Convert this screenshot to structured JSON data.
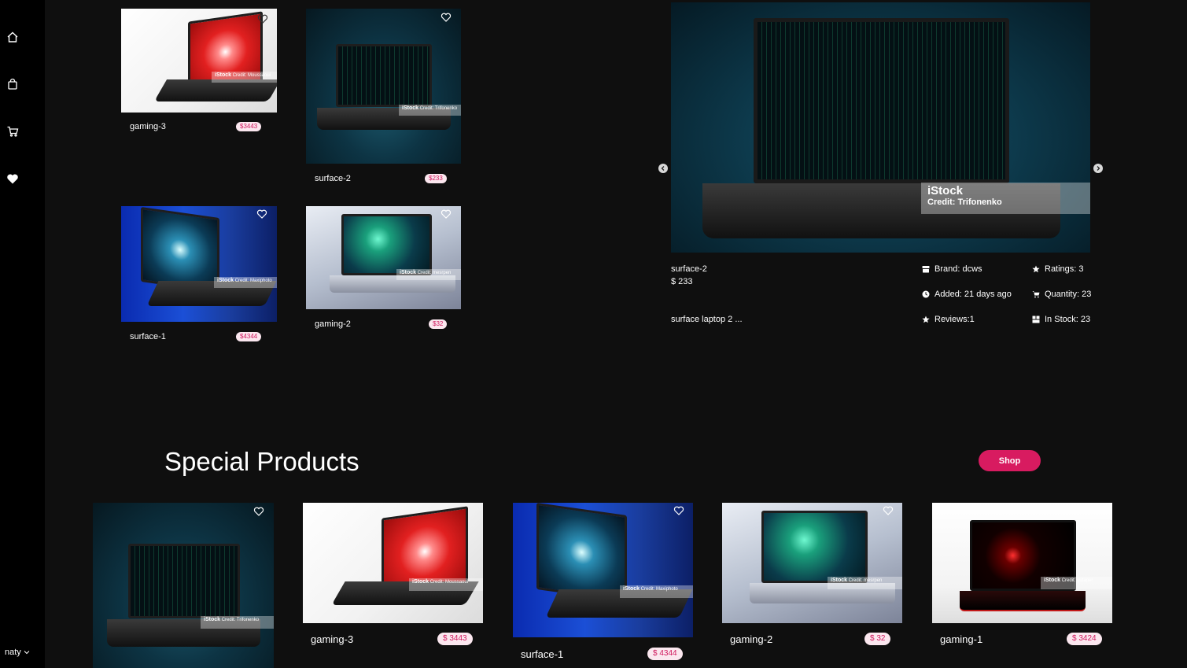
{
  "user": {
    "name": "naty"
  },
  "sidebar": {
    "icons": [
      "home-icon",
      "bag-icon",
      "cart-icon",
      "heart-icon"
    ]
  },
  "grid": [
    {
      "name": "gaming-3",
      "price": "$3443",
      "watermark": "iStock",
      "credit": "Credit: Moussaoui"
    },
    {
      "name": "surface-2",
      "price": "$233",
      "watermark": "iStock",
      "credit": "Credit: Trifonenko"
    },
    {
      "name": "surface-1",
      "price": "$4344",
      "watermark": "iStock",
      "credit": "Credit: Maxiphoto"
    },
    {
      "name": "gaming-2",
      "price": "$32",
      "watermark": "iStock",
      "credit": "Credit: mesrpen"
    }
  ],
  "hero": {
    "watermark": "iStock",
    "credit": "Credit: Trifonenko",
    "name": "surface-2",
    "price": "$ 233",
    "description": "surface laptop 2 ...",
    "brand": "Brand: dcws",
    "added": "Added: 21 days ago",
    "reviews": "Reviews:1",
    "ratings": "Ratings: 3",
    "quantity": "Quantity: 23",
    "in_stock": "In Stock: 23"
  },
  "special": {
    "title": "Special Products",
    "shop_label": "Shop",
    "items": [
      {
        "name": "",
        "price": "",
        "watermark": "iStock",
        "credit": "Credit: Trifonenko"
      },
      {
        "name": "gaming-3",
        "price": "$ 3443",
        "watermark": "iStock",
        "credit": "Credit: Moussaoui"
      },
      {
        "name": "surface-1",
        "price": "$ 4344",
        "watermark": "iStock",
        "credit": "Credit: Maxiphoto"
      },
      {
        "name": "gaming-2",
        "price": "$ 32",
        "watermark": "iStock",
        "credit": "Credit: mesrpen"
      },
      {
        "name": "gaming-1",
        "price": "$ 3424",
        "watermark": "iStock",
        "credit": "Credit: gutaper"
      }
    ]
  },
  "colors": {
    "accent": "#d81b60",
    "price_bg": "#fbe7ef",
    "price_text": "#d0185d",
    "background": "#0f0f0f",
    "sidebar": "#000000"
  }
}
